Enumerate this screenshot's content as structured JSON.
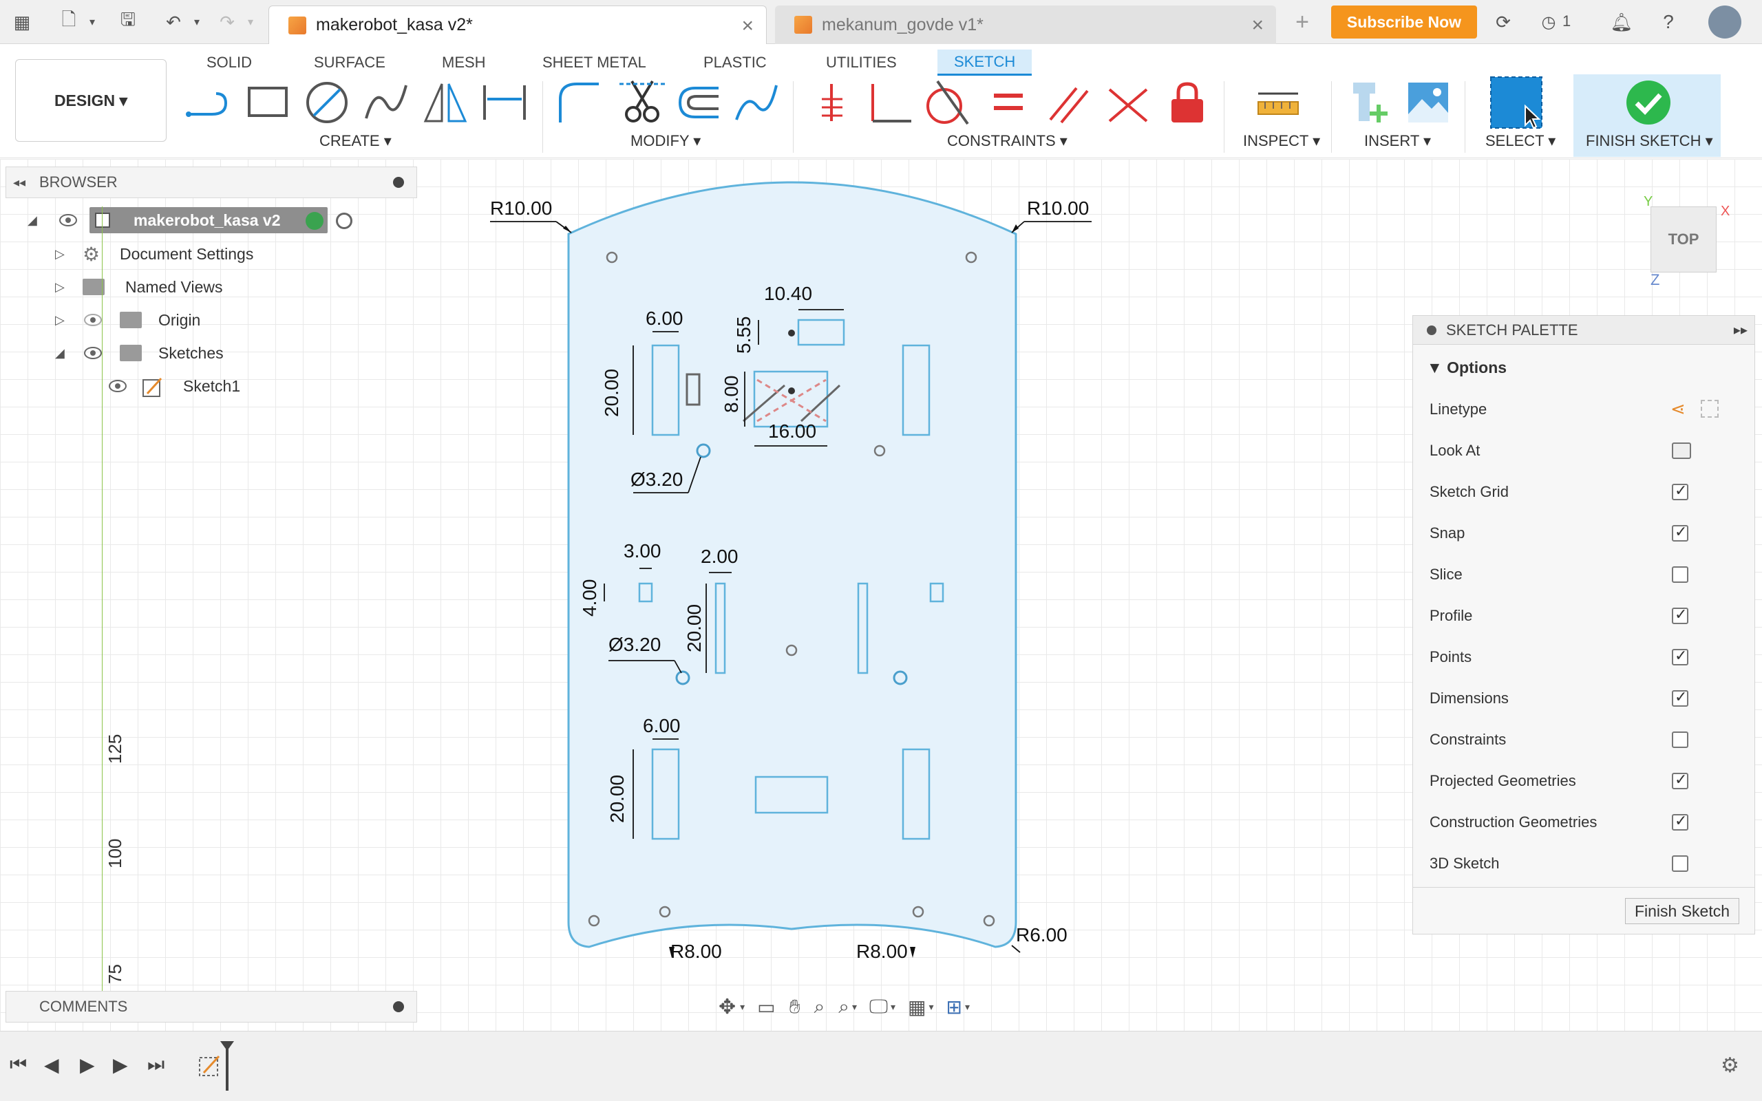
{
  "titlebar": {
    "tabs": [
      {
        "label": "makerobot_kasa v2*",
        "active": true
      },
      {
        "label": "mekanum_govde v1*",
        "active": false
      }
    ],
    "subscribe_label": "Subscribe Now",
    "job_count": "1"
  },
  "ribbon": {
    "workspace_button": "DESIGN ▾",
    "workspace_tabs": [
      "SOLID",
      "SURFACE",
      "MESH",
      "SHEET METAL",
      "PLASTIC",
      "UTILITIES",
      "SKETCH"
    ],
    "active_tab": "SKETCH",
    "groups": {
      "create": "CREATE ▾",
      "modify": "MODIFY ▾",
      "constraints": "CONSTRAINTS ▾",
      "inspect": "INSPECT ▾",
      "insert": "INSERT ▾",
      "select": "SELECT ▾",
      "finish": "FINISH SKETCH ▾"
    }
  },
  "browser": {
    "title": "BROWSER",
    "root": "makerobot_kasa v2",
    "items": [
      "Document Settings",
      "Named Views",
      "Origin",
      "Sketches",
      "Sketch1"
    ]
  },
  "comments": {
    "title": "COMMENTS"
  },
  "ruler": {
    "labels": [
      "125",
      "100",
      "75"
    ]
  },
  "viewcube": {
    "label": "TOP",
    "x": "X",
    "y": "Y",
    "z": "Z"
  },
  "sketch": {
    "dimensions": {
      "r_top_left": "R10.00",
      "r_top_right": "R10.00",
      "w_mount": "10.40",
      "h_mount": "5.55",
      "w_slot_top": "6.00",
      "h_slot_top": "20.00",
      "h_center": "8.00",
      "w_center": "16.00",
      "d_hole_1": "Ø3.20",
      "w_small": "3.00",
      "h_small": "4.00",
      "w_narrow": "2.00",
      "h_narrow": "20.00",
      "d_hole_2": "Ø3.20",
      "w_slot_bottom": "6.00",
      "h_slot_bottom": "20.00",
      "r_bottom_left": "R8.00",
      "r_bottom_right": "R8.00",
      "r_corner": "R6.00"
    }
  },
  "palette": {
    "title": "SKETCH PALETTE",
    "section": "Options",
    "rows": [
      {
        "label": "Linetype",
        "kind": "icons"
      },
      {
        "label": "Look At",
        "kind": "icon"
      },
      {
        "label": "Sketch Grid",
        "checked": true
      },
      {
        "label": "Snap",
        "checked": true
      },
      {
        "label": "Slice",
        "checked": false
      },
      {
        "label": "Profile",
        "checked": true
      },
      {
        "label": "Points",
        "checked": true
      },
      {
        "label": "Dimensions",
        "checked": true
      },
      {
        "label": "Constraints",
        "checked": false
      },
      {
        "label": "Projected Geometries",
        "checked": true
      },
      {
        "label": "Construction Geometries",
        "checked": true
      },
      {
        "label": "3D Sketch",
        "checked": false
      }
    ],
    "finish_button": "Finish Sketch"
  },
  "colors": {
    "accent": "#1c8ad6",
    "subscribe": "#f5951d",
    "sketch_fill": "#e5f2fb",
    "sketch_stroke": "#5fb3dc",
    "finish_check": "#2db84d"
  }
}
